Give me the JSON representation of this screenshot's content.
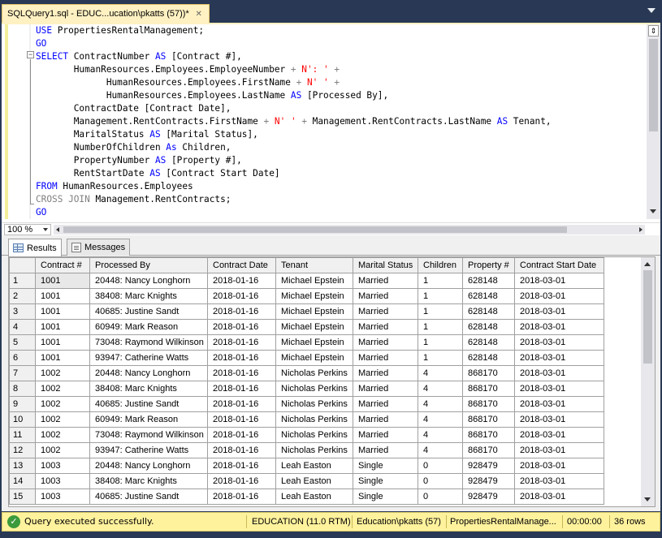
{
  "tab": {
    "title": "SQLQuery1.sql - EDUC...ucation\\pkatts (57))*",
    "close": "✕"
  },
  "editor": {
    "lines": [
      [
        [
          "kw",
          "USE"
        ],
        [
          "pl",
          " PropertiesRentalManagement;"
        ]
      ],
      [
        [
          "kw",
          "GO"
        ]
      ],
      [
        [
          "kw",
          "SELECT"
        ],
        [
          "pl",
          " ContractNumber "
        ],
        [
          "kw",
          "AS"
        ],
        [
          "pl",
          " [Contract #],"
        ]
      ],
      [
        [
          "pl",
          "       HumanResources.Employees.EmployeeNumber "
        ],
        [
          "gr",
          "+"
        ],
        [
          "pl",
          " "
        ],
        [
          "str",
          "N': '"
        ],
        [
          "pl",
          " "
        ],
        [
          "gr",
          "+"
        ]
      ],
      [
        [
          "pl",
          "             HumanResources.Employees.FirstName "
        ],
        [
          "gr",
          "+"
        ],
        [
          "pl",
          " "
        ],
        [
          "str",
          "N' '"
        ],
        [
          "pl",
          " "
        ],
        [
          "gr",
          "+"
        ]
      ],
      [
        [
          "pl",
          "             HumanResources.Employees.LastName "
        ],
        [
          "kw",
          "AS"
        ],
        [
          "pl",
          " [Processed By],"
        ]
      ],
      [
        [
          "pl",
          "       ContractDate [Contract Date],"
        ]
      ],
      [
        [
          "pl",
          "       Management.RentContracts.FirstName "
        ],
        [
          "gr",
          "+"
        ],
        [
          "pl",
          " "
        ],
        [
          "str",
          "N' '"
        ],
        [
          "pl",
          " "
        ],
        [
          "gr",
          "+"
        ],
        [
          "pl",
          " Management.RentContracts.LastName "
        ],
        [
          "kw",
          "AS"
        ],
        [
          "pl",
          " Tenant,"
        ]
      ],
      [
        [
          "pl",
          "       MaritalStatus "
        ],
        [
          "kw",
          "AS"
        ],
        [
          "pl",
          " [Marital Status],"
        ]
      ],
      [
        [
          "pl",
          "       NumberOfChildren "
        ],
        [
          "kw",
          "As"
        ],
        [
          "pl",
          " Children,"
        ]
      ],
      [
        [
          "pl",
          "       PropertyNumber "
        ],
        [
          "kw",
          "AS"
        ],
        [
          "pl",
          " [Property #],"
        ]
      ],
      [
        [
          "pl",
          "       RentStartDate "
        ],
        [
          "kw",
          "AS"
        ],
        [
          "pl",
          " [Contract Start Date]"
        ]
      ],
      [
        [
          "kw",
          "FROM"
        ],
        [
          "pl",
          " HumanResources.Employees"
        ]
      ],
      [
        [
          "gr",
          "CROSS JOIN"
        ],
        [
          "pl",
          " Management.RentContracts;"
        ]
      ],
      [
        [
          "kw",
          "GO"
        ]
      ]
    ]
  },
  "zoom": {
    "label": "100 %"
  },
  "results_tabs": {
    "results": "Results",
    "messages": "Messages"
  },
  "grid": {
    "columns": [
      "Contract #",
      "Processed By",
      "Contract Date",
      "Tenant",
      "Marital Status",
      "Children",
      "Property #",
      "Contract Start Date"
    ],
    "rows": [
      [
        "1",
        "1001",
        "20448: Nancy Longhorn",
        "2018-01-16",
        "Michael Epstein",
        "Married",
        "1",
        "628148",
        "2018-03-01"
      ],
      [
        "2",
        "1001",
        "38408: Marc Knights",
        "2018-01-16",
        "Michael Epstein",
        "Married",
        "1",
        "628148",
        "2018-03-01"
      ],
      [
        "3",
        "1001",
        "40685: Justine Sandt",
        "2018-01-16",
        "Michael Epstein",
        "Married",
        "1",
        "628148",
        "2018-03-01"
      ],
      [
        "4",
        "1001",
        "60949: Mark Reason",
        "2018-01-16",
        "Michael Epstein",
        "Married",
        "1",
        "628148",
        "2018-03-01"
      ],
      [
        "5",
        "1001",
        "73048: Raymond Wilkinson",
        "2018-01-16",
        "Michael Epstein",
        "Married",
        "1",
        "628148",
        "2018-03-01"
      ],
      [
        "6",
        "1001",
        "93947: Catherine Watts",
        "2018-01-16",
        "Michael Epstein",
        "Married",
        "1",
        "628148",
        "2018-03-01"
      ],
      [
        "7",
        "1002",
        "20448: Nancy Longhorn",
        "2018-01-16",
        "Nicholas Perkins",
        "Married",
        "4",
        "868170",
        "2018-03-01"
      ],
      [
        "8",
        "1002",
        "38408: Marc Knights",
        "2018-01-16",
        "Nicholas Perkins",
        "Married",
        "4",
        "868170",
        "2018-03-01"
      ],
      [
        "9",
        "1002",
        "40685: Justine Sandt",
        "2018-01-16",
        "Nicholas Perkins",
        "Married",
        "4",
        "868170",
        "2018-03-01"
      ],
      [
        "10",
        "1002",
        "60949: Mark Reason",
        "2018-01-16",
        "Nicholas Perkins",
        "Married",
        "4",
        "868170",
        "2018-03-01"
      ],
      [
        "11",
        "1002",
        "73048: Raymond Wilkinson",
        "2018-01-16",
        "Nicholas Perkins",
        "Married",
        "4",
        "868170",
        "2018-03-01"
      ],
      [
        "12",
        "1002",
        "93947: Catherine Watts",
        "2018-01-16",
        "Nicholas Perkins",
        "Married",
        "4",
        "868170",
        "2018-03-01"
      ],
      [
        "13",
        "1003",
        "20448: Nancy Longhorn",
        "2018-01-16",
        "Leah Easton",
        "Single",
        "0",
        "928479",
        "2018-03-01"
      ],
      [
        "14",
        "1003",
        "38408: Marc Knights",
        "2018-01-16",
        "Leah Easton",
        "Single",
        "0",
        "928479",
        "2018-03-01"
      ],
      [
        "15",
        "1003",
        "40685: Justine Sandt",
        "2018-01-16",
        "Leah Easton",
        "Single",
        "0",
        "928479",
        "2018-03-01"
      ]
    ]
  },
  "status": {
    "icon": "check-circle-icon",
    "message": "Query executed successfully.",
    "server": "EDUCATION (11.0 RTM)",
    "user": "Education\\pkatts (57)",
    "database": "PropertiesRentalManage...",
    "time": "00:00:00",
    "rows": "36 rows"
  },
  "colors": {
    "frame": "#293955",
    "tab_active": "#fff1c2",
    "status_bar": "#fff29d",
    "keyword": "#0000ff",
    "string": "#ff0000",
    "operator": "#808080"
  }
}
